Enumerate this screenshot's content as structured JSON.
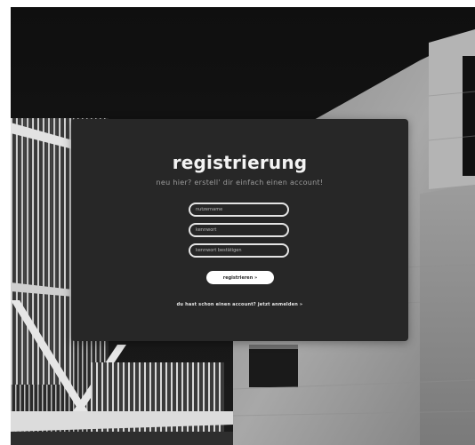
{
  "form": {
    "title": "registrierung",
    "subtitle": "neu hier? erstell' dir einfach einen account!",
    "username_placeholder": "nutzername",
    "password_placeholder": "kennwort",
    "confirm_placeholder": "kennwort bestätigen",
    "submit_label": "registrieren »",
    "login_prompt": "du hast schon einen account?",
    "login_link": "jetzt anmelden »"
  }
}
